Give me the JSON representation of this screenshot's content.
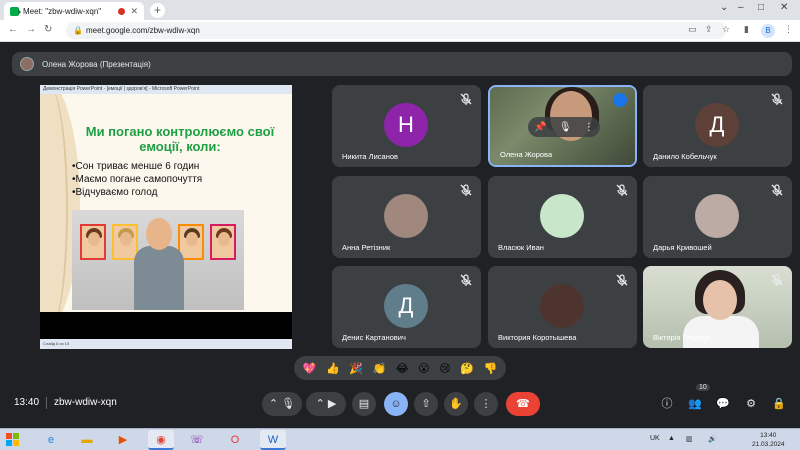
{
  "browser": {
    "tab_title": "Meet: \"zbw-wdiw-xqn\"",
    "tab_close": "✕",
    "new_tab": "+",
    "url": "meet.google.com/zbw-wdiw-xqn",
    "profile_initial": "B",
    "window_controls": [
      "–",
      "□",
      "✕"
    ]
  },
  "presenter": {
    "label": "Олена Жорова (Презентація)"
  },
  "presentation": {
    "window_title": "Демонстрація PowerPoint - [емоції | здоров'я] - Microsoft PowerPoint",
    "heading": "Ми погано контролюємо свої емоції, коли:",
    "bullets": [
      "•Сон триває менше 6 годин",
      "•Маємо погане самопочуття",
      "•Відчуваємо голод"
    ],
    "status_text": "Слайд 6 из 15"
  },
  "participants": [
    {
      "name": "Никита Лисанов",
      "initial": "Н",
      "avatar_color": "#8e24aa",
      "muted": true
    },
    {
      "name": "Олена Жорова",
      "initial": "",
      "avatar_color": "",
      "muted": false,
      "video": true,
      "active": true
    },
    {
      "name": "Данило Кобельчук",
      "initial": "Д",
      "avatar_color": "#5d4037",
      "muted": true
    },
    {
      "name": "Анна Ретізник",
      "initial": "",
      "avatar_color": "#a1887f",
      "muted": true,
      "photo": "cat"
    },
    {
      "name": "Власюк Иван",
      "initial": "",
      "avatar_color": "#c8e6c9",
      "muted": true,
      "photo": "cat-green"
    },
    {
      "name": "Дарья Кривошей",
      "initial": "",
      "avatar_color": "#bcaaa4",
      "muted": true,
      "photo": "person-red-hair"
    },
    {
      "name": "Денис Картанович",
      "initial": "Д",
      "avatar_color": "#607d8b",
      "muted": true
    },
    {
      "name": "Виктория Коротышева",
      "initial": "",
      "avatar_color": "#4e342e",
      "muted": true,
      "photo": "person"
    },
    {
      "name": "Вікторія Гладчук",
      "initial": "",
      "avatar_color": "",
      "muted": true,
      "video": true
    }
  ],
  "reactions": [
    "💖",
    "👍",
    "🎉",
    "👏",
    "😂",
    "😮",
    "😢",
    "🤔",
    "👎"
  ],
  "bottom_bar": {
    "time": "13:40",
    "meeting_code": "zbw-wdiw-xqn",
    "participant_count": "10"
  },
  "taskbar": {
    "language": "UK",
    "clock_time": "13:40",
    "clock_date": "21.03.2024"
  },
  "colors": {
    "meet_bg": "#202124",
    "tile_bg": "#3c4043",
    "accent_blue": "#8ab4f8",
    "hangup_red": "#ea4335",
    "slide_heading_green": "#1e9f44"
  }
}
